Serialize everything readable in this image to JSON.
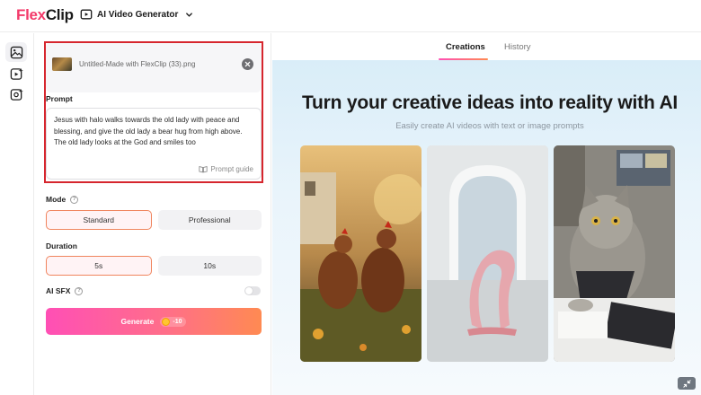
{
  "header": {
    "logo_prefix": "Flex",
    "logo_suffix": "Clip",
    "tool_name": "AI Video Generator"
  },
  "rail": {
    "items": [
      "image-to-video-icon",
      "text-to-video-icon",
      "video-effects-icon"
    ]
  },
  "panel": {
    "upload": {
      "file_name": "Untitled-Made with FlexClip (33).png"
    },
    "prompt": {
      "label": "Prompt",
      "text": "Jesus with halo walks towards the old lady with peace and blessing, and give the old lady a bear hug from high above. The old lady looks at the God and smiles too",
      "guide_label": "Prompt guide"
    },
    "mode": {
      "label": "Mode",
      "options": [
        "Standard",
        "Professional"
      ],
      "selected": "Standard"
    },
    "duration": {
      "label": "Duration",
      "options": [
        "5s",
        "10s"
      ],
      "selected": "5s"
    },
    "sfx": {
      "label": "AI SFX",
      "enabled": false
    },
    "generate": {
      "label": "Generate",
      "credits": "-10"
    }
  },
  "main": {
    "tabs": [
      "Creations",
      "History"
    ],
    "active_tab": "Creations",
    "hero_title": "Turn your creative ideas into reality with AI",
    "hero_subtitle": "Easily create AI videos with text or image prompts"
  },
  "colors": {
    "accent_pink": "#ff4fb5",
    "accent_orange": "#ff8a52",
    "highlight_red": "#d6262e"
  }
}
